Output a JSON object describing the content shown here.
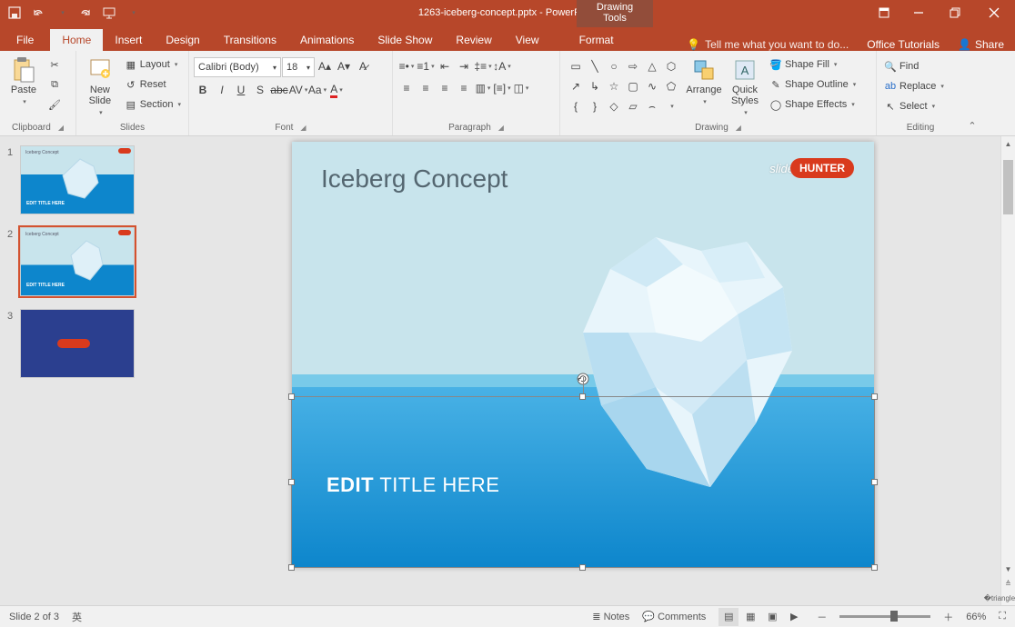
{
  "app": {
    "title": "1263-iceberg-concept.pptx - PowerPoint",
    "drawing_tools": "Drawing Tools"
  },
  "qat": {
    "save": "save",
    "undo": "undo",
    "redo": "redo",
    "start": "start-from-beginning"
  },
  "tabs": {
    "file": "File",
    "home": "Home",
    "insert": "Insert",
    "design": "Design",
    "transitions": "Transitions",
    "animations": "Animations",
    "slideshow": "Slide Show",
    "review": "Review",
    "view": "View",
    "format": "Format"
  },
  "tellme": "Tell me what you want to do...",
  "rightlinks": {
    "tutorials": "Office Tutorials",
    "share": "Share"
  },
  "ribbon": {
    "clipboard": {
      "label": "Clipboard",
      "paste": "Paste",
      "cut": "Cut",
      "copy": "Copy",
      "fmt": "Format Painter"
    },
    "slides": {
      "label": "Slides",
      "new": "New\nSlide",
      "layout": "Layout",
      "reset": "Reset",
      "section": "Section"
    },
    "font": {
      "label": "Font",
      "name": "Calibri (Body)",
      "size": "18"
    },
    "paragraph": {
      "label": "Paragraph"
    },
    "drawing": {
      "label": "Drawing",
      "arrange": "Arrange",
      "quick": "Quick\nStyles",
      "fill": "Shape Fill",
      "outline": "Shape Outline",
      "effects": "Shape Effects"
    },
    "editing": {
      "label": "Editing",
      "find": "Find",
      "replace": "Replace",
      "select": "Select"
    }
  },
  "thumbs": {
    "t1": "1",
    "t2": "2",
    "t3": "3",
    "mini_title": "Iceberg Concept",
    "mini_edit": "EDIT TITLE HERE"
  },
  "slide": {
    "title": "Iceberg Concept",
    "edit_bold": "EDIT",
    "edit_rest": " TITLE HERE",
    "logo_pre": "slide",
    "logo_blob": "HUNTER"
  },
  "status": {
    "slide": "Slide 2 of 3",
    "lang": "",
    "notes": "Notes",
    "comments": "Comments",
    "zoom": "66%"
  }
}
